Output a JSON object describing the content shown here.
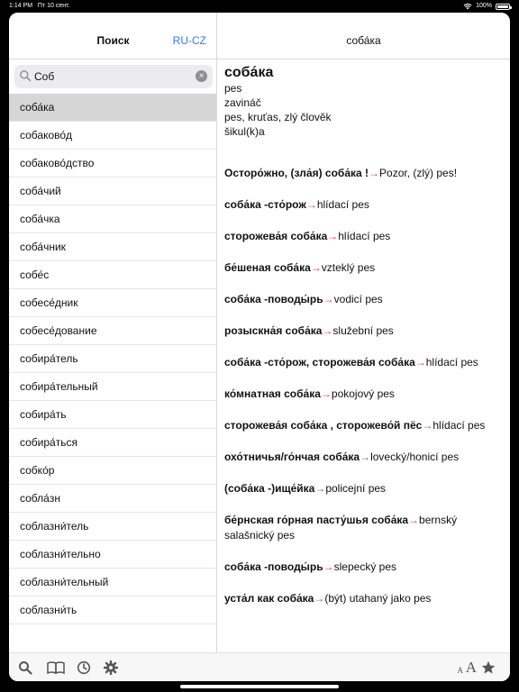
{
  "status": {
    "time": "1:14 PM",
    "date": "Пт 10 сент.",
    "battery": "100%"
  },
  "sidebar": {
    "title": "Поиск",
    "lang": "RU-CZ",
    "search": {
      "value": "Соб",
      "placeholder": ""
    },
    "words": [
      "соба́ка",
      "собаково́д",
      "собаково́дство",
      "соба́чий",
      "соба́чка",
      "соба́чник",
      "собе́с",
      "собесе́дник",
      "собесе́дование",
      "собира́тель",
      "собира́тельный",
      "собира́ть",
      "собира́ться",
      "собко́р",
      "собла́зн",
      "соблазни́тель",
      "соблазни́тельно",
      "соблазни́тельный",
      "соблазни́ть"
    ],
    "selected_index": 0
  },
  "toolbar_left": {
    "icons": [
      "search-icon",
      "book-icon",
      "history-icon",
      "settings-icon"
    ]
  },
  "detail": {
    "title": "соба́ка",
    "headword": "соба́ка",
    "translations": [
      "pes",
      "zavináč",
      "pes, kruťas, zlý člověk",
      "šikul(k)a"
    ],
    "examples": [
      {
        "ru": "Осторо́жно, (зла́я) соба́ка !",
        "arrow": "→",
        "cz": "Pozor, (zlý) pes!"
      },
      {
        "ru": "соба́ка -сто́рож",
        "arrow": "→",
        "cz": "hlídací pes"
      },
      {
        "ru": "сторожева́я соба́ка",
        "arrow": "→",
        "cz": "hlídací pes"
      },
      {
        "ru": "бе́шеная соба́ка",
        "arrow": "→",
        "cz": "vzteklý pes"
      },
      {
        "ru": "соба́ка -поводы́рь",
        "arrow": "→",
        "cz": "vodicí pes"
      },
      {
        "ru": "розыскна́я соба́ка",
        "arrow": "→",
        "cz": "služební pes"
      },
      {
        "ru": "соба́ка -сто́рож, сторожева́я соба́ка",
        "arrow": "→",
        "cz": "hlídací pes"
      },
      {
        "ru": "ко́мнатная соба́ка",
        "arrow": "→",
        "cz": "pokojový pes"
      },
      {
        "ru": "сторожева́я соба́ка , сторожево́й пёс",
        "arrow": "→",
        "cz": "hlídací pes"
      },
      {
        "ru": "охо́тничья/го́нчая соба́ка",
        "arrow": "→",
        "cz": "lovecký/honicí pes"
      },
      {
        "ru": "(соба́ка -)ище́йка",
        "arrow": "→",
        "cz": "policejní pes"
      },
      {
        "ru": "бе́рнская го́рная пасту́шья соба́ка",
        "arrow": "→",
        "cz": "bernský salašnický pes"
      },
      {
        "ru": "соба́ка -поводы́рь",
        "arrow": "→",
        "cz": "slepecký pes"
      },
      {
        "ru": "уста́л как соба́ка",
        "arrow": "→",
        "cz": "(být) utahaný jako pes"
      }
    ]
  },
  "toolbar_right": {
    "font_small": "A",
    "font_big": "A",
    "icons": [
      "star-icon"
    ]
  }
}
